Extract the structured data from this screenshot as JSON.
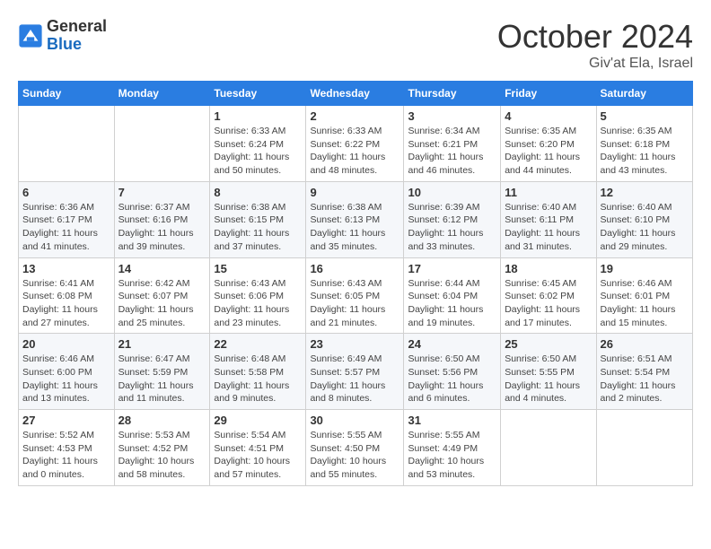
{
  "logo": {
    "general": "General",
    "blue": "Blue"
  },
  "title": "October 2024",
  "location": "Giv'at Ela, Israel",
  "headers": [
    "Sunday",
    "Monday",
    "Tuesday",
    "Wednesday",
    "Thursday",
    "Friday",
    "Saturday"
  ],
  "weeks": [
    [
      {
        "day": "",
        "info": ""
      },
      {
        "day": "",
        "info": ""
      },
      {
        "day": "1",
        "info": "Sunrise: 6:33 AM\nSunset: 6:24 PM\nDaylight: 11 hours and 50 minutes."
      },
      {
        "day": "2",
        "info": "Sunrise: 6:33 AM\nSunset: 6:22 PM\nDaylight: 11 hours and 48 minutes."
      },
      {
        "day": "3",
        "info": "Sunrise: 6:34 AM\nSunset: 6:21 PM\nDaylight: 11 hours and 46 minutes."
      },
      {
        "day": "4",
        "info": "Sunrise: 6:35 AM\nSunset: 6:20 PM\nDaylight: 11 hours and 44 minutes."
      },
      {
        "day": "5",
        "info": "Sunrise: 6:35 AM\nSunset: 6:18 PM\nDaylight: 11 hours and 43 minutes."
      }
    ],
    [
      {
        "day": "6",
        "info": "Sunrise: 6:36 AM\nSunset: 6:17 PM\nDaylight: 11 hours and 41 minutes."
      },
      {
        "day": "7",
        "info": "Sunrise: 6:37 AM\nSunset: 6:16 PM\nDaylight: 11 hours and 39 minutes."
      },
      {
        "day": "8",
        "info": "Sunrise: 6:38 AM\nSunset: 6:15 PM\nDaylight: 11 hours and 37 minutes."
      },
      {
        "day": "9",
        "info": "Sunrise: 6:38 AM\nSunset: 6:13 PM\nDaylight: 11 hours and 35 minutes."
      },
      {
        "day": "10",
        "info": "Sunrise: 6:39 AM\nSunset: 6:12 PM\nDaylight: 11 hours and 33 minutes."
      },
      {
        "day": "11",
        "info": "Sunrise: 6:40 AM\nSunset: 6:11 PM\nDaylight: 11 hours and 31 minutes."
      },
      {
        "day": "12",
        "info": "Sunrise: 6:40 AM\nSunset: 6:10 PM\nDaylight: 11 hours and 29 minutes."
      }
    ],
    [
      {
        "day": "13",
        "info": "Sunrise: 6:41 AM\nSunset: 6:08 PM\nDaylight: 11 hours and 27 minutes."
      },
      {
        "day": "14",
        "info": "Sunrise: 6:42 AM\nSunset: 6:07 PM\nDaylight: 11 hours and 25 minutes."
      },
      {
        "day": "15",
        "info": "Sunrise: 6:43 AM\nSunset: 6:06 PM\nDaylight: 11 hours and 23 minutes."
      },
      {
        "day": "16",
        "info": "Sunrise: 6:43 AM\nSunset: 6:05 PM\nDaylight: 11 hours and 21 minutes."
      },
      {
        "day": "17",
        "info": "Sunrise: 6:44 AM\nSunset: 6:04 PM\nDaylight: 11 hours and 19 minutes."
      },
      {
        "day": "18",
        "info": "Sunrise: 6:45 AM\nSunset: 6:02 PM\nDaylight: 11 hours and 17 minutes."
      },
      {
        "day": "19",
        "info": "Sunrise: 6:46 AM\nSunset: 6:01 PM\nDaylight: 11 hours and 15 minutes."
      }
    ],
    [
      {
        "day": "20",
        "info": "Sunrise: 6:46 AM\nSunset: 6:00 PM\nDaylight: 11 hours and 13 minutes."
      },
      {
        "day": "21",
        "info": "Sunrise: 6:47 AM\nSunset: 5:59 PM\nDaylight: 11 hours and 11 minutes."
      },
      {
        "day": "22",
        "info": "Sunrise: 6:48 AM\nSunset: 5:58 PM\nDaylight: 11 hours and 9 minutes."
      },
      {
        "day": "23",
        "info": "Sunrise: 6:49 AM\nSunset: 5:57 PM\nDaylight: 11 hours and 8 minutes."
      },
      {
        "day": "24",
        "info": "Sunrise: 6:50 AM\nSunset: 5:56 PM\nDaylight: 11 hours and 6 minutes."
      },
      {
        "day": "25",
        "info": "Sunrise: 6:50 AM\nSunset: 5:55 PM\nDaylight: 11 hours and 4 minutes."
      },
      {
        "day": "26",
        "info": "Sunrise: 6:51 AM\nSunset: 5:54 PM\nDaylight: 11 hours and 2 minutes."
      }
    ],
    [
      {
        "day": "27",
        "info": "Sunrise: 5:52 AM\nSunset: 4:53 PM\nDaylight: 11 hours and 0 minutes."
      },
      {
        "day": "28",
        "info": "Sunrise: 5:53 AM\nSunset: 4:52 PM\nDaylight: 10 hours and 58 minutes."
      },
      {
        "day": "29",
        "info": "Sunrise: 5:54 AM\nSunset: 4:51 PM\nDaylight: 10 hours and 57 minutes."
      },
      {
        "day": "30",
        "info": "Sunrise: 5:55 AM\nSunset: 4:50 PM\nDaylight: 10 hours and 55 minutes."
      },
      {
        "day": "31",
        "info": "Sunrise: 5:55 AM\nSunset: 4:49 PM\nDaylight: 10 hours and 53 minutes."
      },
      {
        "day": "",
        "info": ""
      },
      {
        "day": "",
        "info": ""
      }
    ]
  ]
}
